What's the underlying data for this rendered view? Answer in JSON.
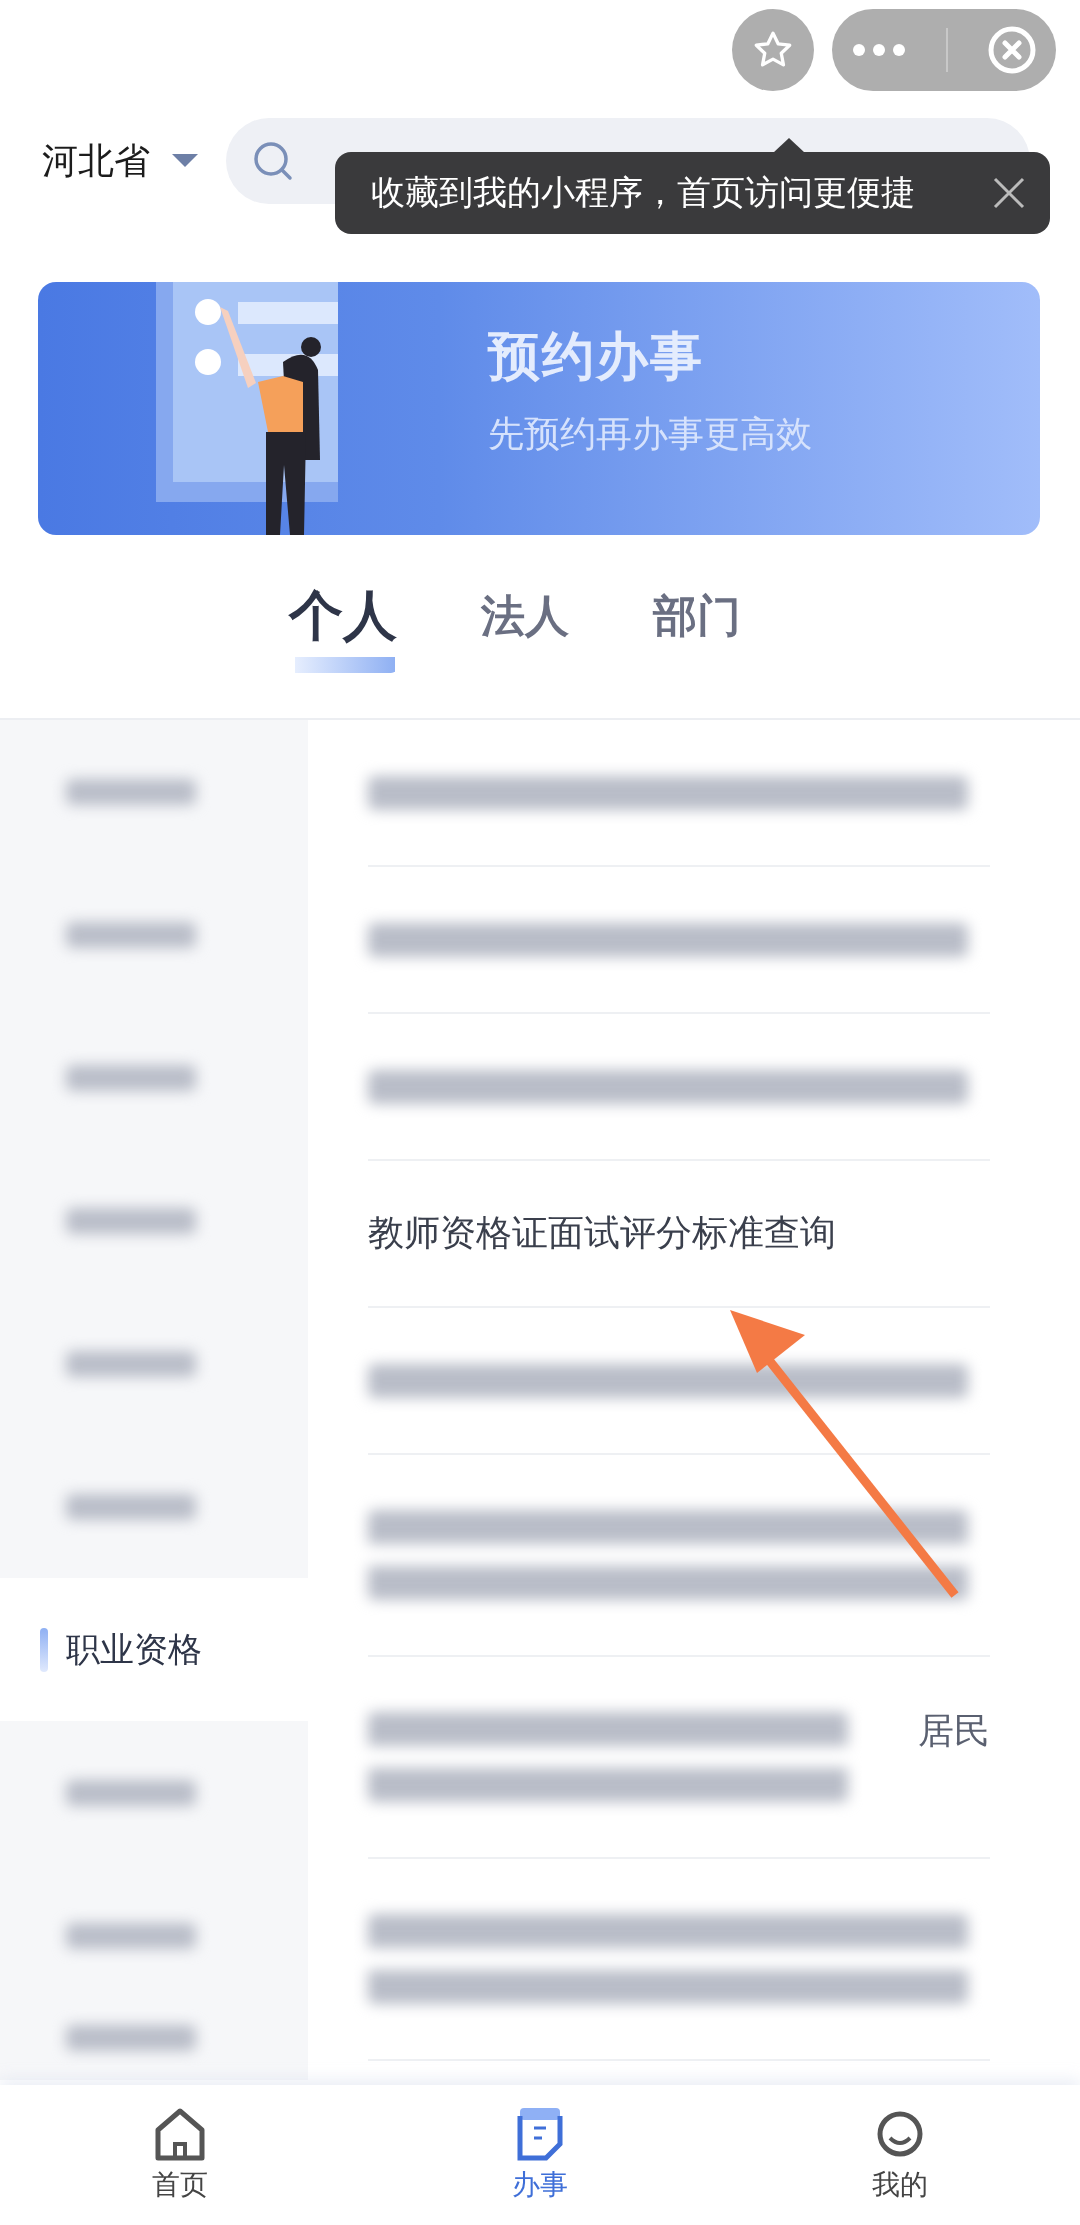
{
  "header": {
    "region": "河北省"
  },
  "tooltip": {
    "text": "收藏到我的小程序，首页访问更便捷"
  },
  "banner": {
    "title": "预约办事",
    "subtitle": "先预约再办事更高效"
  },
  "tabs": [
    {
      "label": "个人",
      "selected": true
    },
    {
      "label": "法人",
      "selected": false
    },
    {
      "label": "部门",
      "selected": false
    }
  ],
  "sidebar": {
    "items": [
      {
        "kind": "blurred",
        "selected": false
      },
      {
        "kind": "blurred",
        "selected": false
      },
      {
        "kind": "blurred",
        "selected": false
      },
      {
        "kind": "blurred",
        "selected": false
      },
      {
        "kind": "blurred",
        "selected": false
      },
      {
        "kind": "blurred",
        "selected": false
      },
      {
        "kind": "text",
        "label": "职业资格",
        "selected": true
      },
      {
        "kind": "blurred",
        "selected": false
      },
      {
        "kind": "blurred",
        "selected": false
      },
      {
        "kind": "blurred",
        "selected": false
      }
    ]
  },
  "list": {
    "items": [
      {
        "kind": "blurred"
      },
      {
        "kind": "blurred"
      },
      {
        "kind": "blurred"
      },
      {
        "kind": "text",
        "label": "教师资格证面试评分标准查询"
      },
      {
        "kind": "blurred"
      },
      {
        "kind": "blurred-two-line"
      },
      {
        "kind": "partial-two-line",
        "label": "居民"
      },
      {
        "kind": "blurred-two-line"
      }
    ]
  },
  "bottom_nav": [
    {
      "label": "首页",
      "selected": false
    },
    {
      "label": "办事",
      "selected": true
    },
    {
      "label": "我的",
      "selected": false
    }
  ]
}
